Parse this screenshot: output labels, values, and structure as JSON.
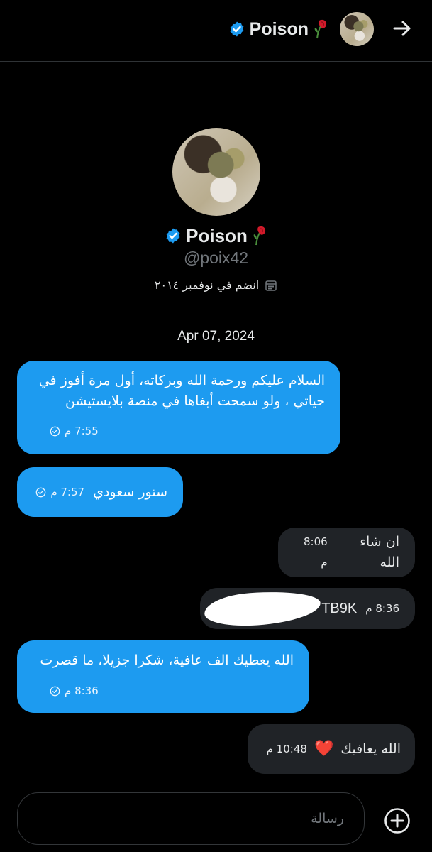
{
  "header": {
    "name": "Poison",
    "back_icon": "arrow-right-icon",
    "verified_icon": "verified-badge-icon",
    "emoji": "wilted-rose-emoji"
  },
  "profile": {
    "name": "Poison",
    "handle": "@poix42",
    "joined": "انضم في نوفمبر ٢٠١٤",
    "joined_icon": "calendar-icon"
  },
  "date_separator": "Apr 07, 2024",
  "messages": [
    {
      "direction": "outgoing",
      "text": "السلام عليكم ورحمة الله وبركاته،  أول مرة أفوز في حياتي ، ولو سمحت أبغاها في منصة بلايستيشن",
      "time": "7:55 م",
      "status_icon": "check-circle-icon"
    },
    {
      "direction": "outgoing",
      "text": "ستور سعودي",
      "time": "7:57 م",
      "status_icon": "check-circle-icon"
    },
    {
      "direction": "incoming",
      "text": "ان شاء الله",
      "time": "8:06 م"
    },
    {
      "direction": "incoming",
      "text": "TB9K",
      "time": "8:36 م",
      "redacted": true
    },
    {
      "direction": "outgoing",
      "text": "الله يعطيك الف عافية، شكرا جزيلا، ما قصرت",
      "time": "8:36 م",
      "status_icon": "check-circle-icon"
    },
    {
      "direction": "incoming",
      "text": "الله يعافيك",
      "emoji": "❤️",
      "time": "10:48 م"
    }
  ],
  "composer": {
    "placeholder": "رسالة",
    "value": "",
    "add_icon": "plus-circle-icon"
  },
  "colors": {
    "background": "#000000",
    "outgoing_bubble": "#1d9bf0",
    "incoming_bubble": "#202327",
    "verified": "#1d9bf0",
    "secondary_text": "#71767b"
  }
}
